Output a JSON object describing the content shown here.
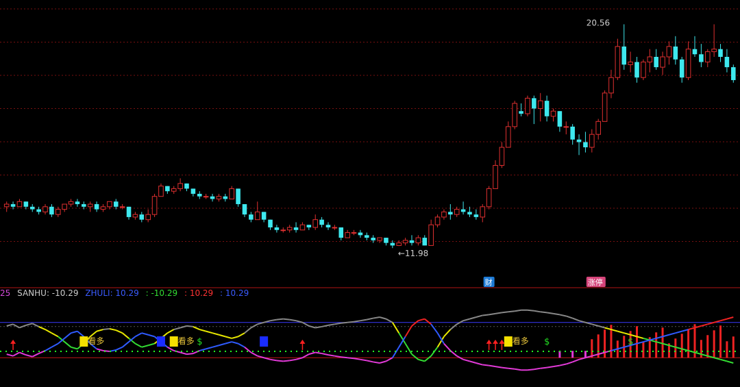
{
  "chart_data": {
    "type": "candlestick",
    "price_panel": {
      "ylim": [
        10.5,
        21.5
      ],
      "annotations": {
        "low_label": "←11.98",
        "high_label": "20.56"
      },
      "event_tags": [
        {
          "index": 75,
          "text": "财",
          "color": "#1e7bd6"
        },
        {
          "index": 91,
          "text": "涨停",
          "color": "#d6447a"
        }
      ],
      "candles": [
        [
          13.5,
          13.7,
          13.3,
          13.6
        ],
        [
          13.6,
          13.7,
          13.4,
          13.5
        ],
        [
          13.5,
          13.8,
          13.5,
          13.7
        ],
        [
          13.7,
          13.7,
          13.4,
          13.5
        ],
        [
          13.5,
          13.6,
          13.3,
          13.4
        ],
        [
          13.4,
          13.5,
          13.2,
          13.3
        ],
        [
          13.3,
          13.6,
          13.2,
          13.5
        ],
        [
          13.5,
          13.6,
          13.1,
          13.2
        ],
        [
          13.2,
          13.5,
          13.1,
          13.4
        ],
        [
          13.4,
          13.6,
          13.3,
          13.6
        ],
        [
          13.6,
          13.8,
          13.5,
          13.7
        ],
        [
          13.7,
          13.8,
          13.5,
          13.6
        ],
        [
          13.6,
          13.7,
          13.4,
          13.5
        ],
        [
          13.5,
          13.7,
          13.3,
          13.6
        ],
        [
          13.6,
          13.7,
          13.3,
          13.4
        ],
        [
          13.4,
          13.6,
          13.3,
          13.5
        ],
        [
          13.5,
          13.7,
          13.4,
          13.7
        ],
        [
          13.7,
          13.8,
          13.4,
          13.5
        ],
        [
          13.5,
          13.6,
          13.4,
          13.5
        ],
        [
          13.5,
          13.5,
          13.0,
          13.1
        ],
        [
          13.1,
          13.3,
          13.0,
          13.2
        ],
        [
          13.2,
          13.3,
          12.9,
          13.0
        ],
        [
          13.0,
          13.4,
          12.9,
          13.2
        ],
        [
          13.2,
          14.0,
          13.1,
          13.9
        ],
        [
          13.9,
          14.4,
          13.9,
          14.3
        ],
        [
          14.3,
          14.3,
          14.0,
          14.1
        ],
        [
          14.1,
          14.3,
          14.0,
          14.2
        ],
        [
          14.2,
          14.6,
          14.1,
          14.4
        ],
        [
          14.4,
          14.4,
          14.1,
          14.2
        ],
        [
          14.2,
          14.2,
          13.9,
          14.0
        ],
        [
          14.0,
          14.1,
          13.8,
          13.9
        ],
        [
          13.9,
          14.0,
          13.8,
          13.9
        ],
        [
          13.9,
          14.0,
          13.7,
          13.8
        ],
        [
          13.8,
          14.0,
          13.7,
          13.9
        ],
        [
          13.9,
          14.0,
          13.7,
          13.8
        ],
        [
          13.8,
          14.3,
          13.8,
          14.2
        ],
        [
          14.2,
          14.2,
          13.5,
          13.6
        ],
        [
          13.6,
          13.6,
          13.1,
          13.2
        ],
        [
          13.2,
          13.3,
          12.9,
          13.0
        ],
        [
          13.0,
          13.7,
          13.0,
          13.3
        ],
        [
          13.3,
          13.3,
          12.9,
          13.0
        ],
        [
          13.0,
          13.0,
          12.6,
          12.7
        ],
        [
          12.7,
          12.8,
          12.5,
          12.6
        ],
        [
          12.6,
          12.7,
          12.5,
          12.6
        ],
        [
          12.6,
          12.8,
          12.5,
          12.7
        ],
        [
          12.7,
          12.9,
          12.5,
          12.6
        ],
        [
          12.6,
          12.9,
          12.6,
          12.8
        ],
        [
          12.8,
          12.8,
          12.6,
          12.7
        ],
        [
          12.7,
          13.2,
          12.6,
          13.0
        ],
        [
          13.0,
          13.1,
          12.7,
          12.8
        ],
        [
          12.8,
          12.9,
          12.6,
          12.7
        ],
        [
          12.7,
          12.8,
          12.6,
          12.7
        ],
        [
          12.7,
          12.7,
          12.2,
          12.3
        ],
        [
          12.3,
          12.6,
          12.3,
          12.5
        ],
        [
          12.5,
          12.6,
          12.4,
          12.5
        ],
        [
          12.5,
          12.6,
          12.3,
          12.4
        ],
        [
          12.4,
          12.5,
          12.2,
          12.3
        ],
        [
          12.3,
          12.4,
          12.1,
          12.2
        ],
        [
          12.2,
          12.3,
          12.1,
          12.3
        ],
        [
          12.3,
          12.3,
          12.0,
          12.1
        ],
        [
          12.1,
          12.2,
          11.9,
          12.0
        ],
        [
          12.0,
          12.2,
          11.98,
          12.1
        ],
        [
          12.1,
          12.3,
          12.0,
          12.2
        ],
        [
          12.2,
          12.4,
          12.0,
          12.1
        ],
        [
          12.1,
          12.4,
          12.0,
          12.3
        ],
        [
          12.3,
          12.4,
          12.0,
          12.0
        ],
        [
          12.0,
          13.0,
          12.0,
          12.8
        ],
        [
          12.8,
          13.2,
          12.7,
          13.1
        ],
        [
          13.1,
          13.4,
          13.0,
          13.3
        ],
        [
          13.3,
          13.6,
          13.0,
          13.2
        ],
        [
          13.2,
          13.5,
          13.1,
          13.4
        ],
        [
          13.4,
          13.7,
          13.2,
          13.3
        ],
        [
          13.3,
          13.5,
          13.1,
          13.2
        ],
        [
          13.2,
          13.4,
          13.0,
          13.1
        ],
        [
          13.1,
          13.6,
          12.9,
          13.5
        ],
        [
          13.5,
          14.3,
          13.4,
          14.2
        ],
        [
          14.2,
          15.3,
          14.2,
          15.1
        ],
        [
          15.1,
          16.0,
          15.0,
          15.8
        ],
        [
          15.8,
          16.8,
          15.8,
          16.6
        ],
        [
          16.6,
          17.6,
          16.5,
          17.5
        ],
        [
          17.2,
          17.5,
          17.0,
          17.1
        ],
        [
          17.1,
          17.8,
          17.0,
          17.7
        ],
        [
          17.7,
          17.8,
          16.7,
          17.3
        ],
        [
          17.3,
          17.9,
          16.8,
          17.6
        ],
        [
          17.6,
          17.8,
          16.8,
          17.0
        ],
        [
          17.0,
          17.3,
          16.8,
          17.2
        ],
        [
          17.2,
          17.2,
          16.4,
          16.6
        ],
        [
          16.6,
          16.8,
          16.3,
          16.6
        ],
        [
          16.6,
          16.7,
          15.9,
          16.1
        ],
        [
          16.1,
          16.3,
          15.5,
          16.0
        ],
        [
          16.0,
          16.4,
          15.6,
          15.8
        ],
        [
          15.8,
          16.5,
          15.6,
          16.3
        ],
        [
          16.3,
          16.9,
          16.1,
          16.8
        ],
        [
          16.8,
          18.0,
          16.8,
          17.9
        ],
        [
          17.9,
          18.8,
          17.7,
          18.5
        ],
        [
          18.5,
          20.0,
          18.4,
          19.7
        ],
        [
          19.7,
          20.56,
          18.8,
          19.0
        ],
        [
          19.0,
          19.5,
          18.7,
          19.1
        ],
        [
          19.1,
          19.3,
          18.3,
          18.5
        ],
        [
          18.5,
          19.2,
          18.4,
          19.1
        ],
        [
          19.1,
          19.6,
          18.7,
          19.3
        ],
        [
          19.3,
          19.6,
          18.8,
          18.9
        ],
        [
          18.9,
          19.5,
          18.6,
          19.3
        ],
        [
          19.3,
          19.9,
          19.0,
          19.7
        ],
        [
          19.7,
          20.1,
          19.0,
          19.2
        ],
        [
          19.2,
          19.3,
          18.3,
          18.5
        ],
        [
          18.5,
          19.9,
          18.4,
          19.6
        ],
        [
          19.6,
          20.1,
          19.3,
          19.4
        ],
        [
          19.4,
          19.8,
          18.9,
          19.1
        ],
        [
          19.1,
          19.6,
          18.9,
          19.5
        ],
        [
          19.5,
          20.56,
          19.3,
          19.6
        ],
        [
          19.6,
          19.8,
          19.1,
          19.3
        ],
        [
          19.3,
          19.6,
          18.7,
          18.9
        ],
        [
          18.9,
          19.0,
          18.3,
          18.4
        ]
      ]
    },
    "indicator_panel": {
      "legend": [
        {
          "text": "25",
          "color": "#d64adb"
        },
        {
          "text": "SANHU: -10.29",
          "color": "#cccccc"
        },
        {
          "text": "ZHULI: 10.29",
          "color": "#3a5bff"
        },
        {
          "text": ": -10.29",
          "color": "#33dd33"
        },
        {
          "text": ": 10.29",
          "color": "#ff3333"
        },
        {
          "text": ": 10.29",
          "color": "#3a5bff"
        }
      ],
      "ylim": [
        -100,
        100
      ],
      "upper_ref": 50,
      "lower_ref": -50,
      "sanhu_line": [
        40,
        45,
        35,
        42,
        47,
        38,
        30,
        20,
        10,
        -5,
        -20,
        -25,
        -10,
        10,
        25,
        30,
        32,
        28,
        20,
        5,
        -10,
        -20,
        -15,
        -10,
        5,
        20,
        30,
        35,
        40,
        38,
        30,
        25,
        20,
        15,
        10,
        5,
        10,
        20,
        35,
        45,
        50,
        55,
        58,
        60,
        58,
        55,
        50,
        40,
        35,
        38,
        42,
        45,
        48,
        50,
        52,
        55,
        58,
        62,
        65,
        60,
        50,
        20,
        -10,
        -40,
        -55,
        -60,
        -45,
        -20,
        10,
        30,
        45,
        55,
        60,
        65,
        70,
        72,
        75,
        78,
        80,
        82,
        85,
        85,
        83,
        80,
        78,
        75,
        72,
        68,
        62,
        55,
        50,
        45,
        40,
        35,
        30,
        25,
        20,
        15,
        10,
        5,
        0,
        -5,
        -10,
        -15,
        -20,
        -25,
        -30,
        -35,
        -40,
        -45,
        -50,
        -55,
        -60,
        -65
      ],
      "zhuli_line": [
        -40,
        -45,
        -35,
        -42,
        -47,
        -38,
        -30,
        -20,
        -10,
        5,
        20,
        25,
        10,
        -10,
        -25,
        -30,
        -32,
        -28,
        -20,
        -5,
        10,
        20,
        15,
        10,
        -5,
        -20,
        -30,
        -35,
        -40,
        -38,
        -30,
        -25,
        -20,
        -15,
        -10,
        -5,
        -10,
        -20,
        -35,
        -45,
        -50,
        -55,
        -58,
        -60,
        -58,
        -55,
        -50,
        -40,
        -35,
        -38,
        -42,
        -45,
        -48,
        -50,
        -52,
        -55,
        -58,
        -62,
        -65,
        -60,
        -50,
        -20,
        10,
        40,
        55,
        60,
        45,
        20,
        -10,
        -30,
        -45,
        -55,
        -60,
        -65,
        -70,
        -72,
        -75,
        -78,
        -80,
        -82,
        -85,
        -85,
        -83,
        -80,
        -78,
        -75,
        -72,
        -68,
        -62,
        -55,
        -50,
        -45,
        -40,
        -35,
        -30,
        -25,
        -20,
        -15,
        -10,
        -5,
        0,
        5,
        10,
        15,
        20,
        25,
        30,
        35,
        40,
        45,
        50,
        55,
        60,
        65
      ],
      "signal_labels": [
        {
          "index": 12,
          "text": "看多",
          "color": "#e8c43a"
        },
        {
          "index": 26,
          "text": "看多",
          "color": "#e8c43a"
        },
        {
          "index": 78,
          "text": "看多",
          "color": "#e8c43a"
        }
      ],
      "dollar_marks": [
        30,
        84,
        97
      ],
      "up_arrows": [
        1,
        46,
        75,
        76,
        77
      ],
      "yellow_boxes": [
        12,
        26,
        78
      ],
      "blue_boxes": [
        24,
        40
      ],
      "bars_red": [
        91,
        92,
        93,
        94,
        95,
        96,
        97,
        98,
        99,
        100,
        101,
        102,
        103,
        104,
        105,
        106,
        107,
        108,
        109,
        110,
        111,
        112,
        113,
        114,
        115,
        116,
        117,
        118,
        119
      ],
      "bars_magenta": [
        86,
        88,
        90
      ]
    }
  }
}
